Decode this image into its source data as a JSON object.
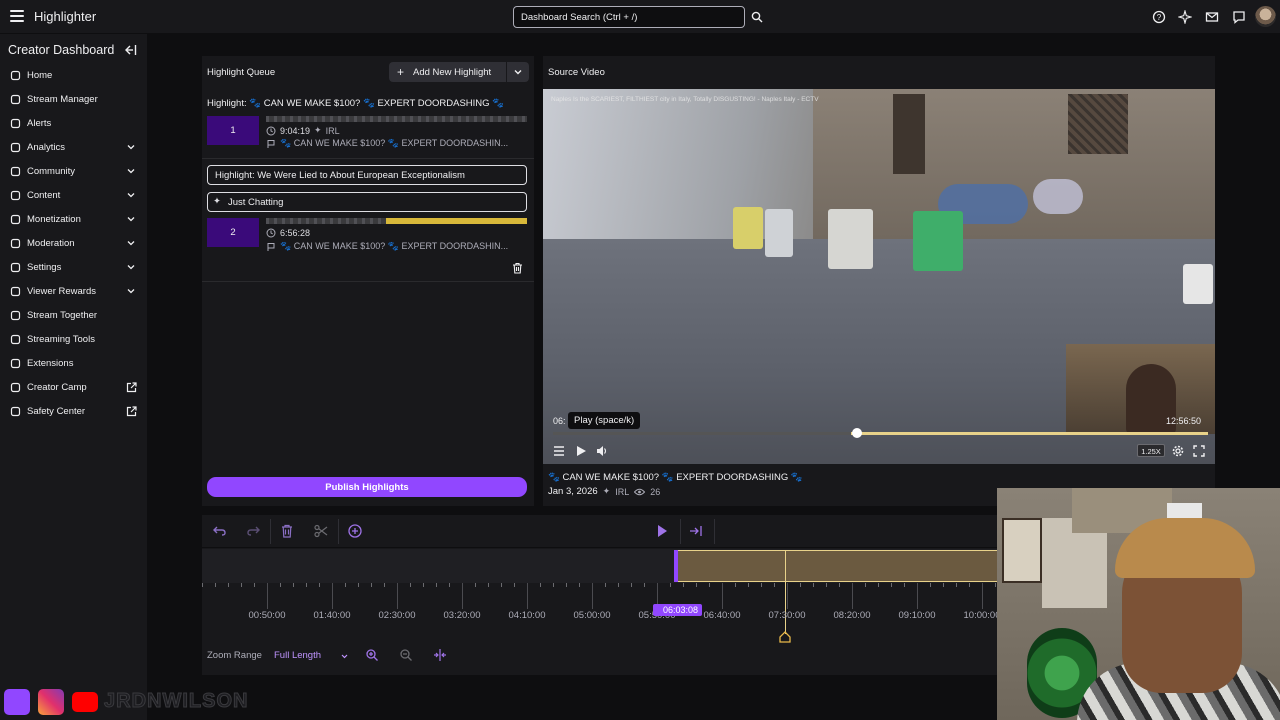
{
  "topbar": {
    "app_title": "Highlighter",
    "search_placeholder": "Dashboard Search (Ctrl + /)"
  },
  "sidebar": {
    "title": "Creator Dashboard",
    "items": [
      {
        "label": "Home",
        "icon": "home-icon",
        "expandable": false,
        "external": false
      },
      {
        "label": "Stream Manager",
        "icon": "stream-manager-icon",
        "expandable": false,
        "external": false
      },
      {
        "label": "Alerts",
        "icon": "alerts-icon",
        "expandable": false,
        "external": false
      },
      {
        "label": "Analytics",
        "icon": "analytics-icon",
        "expandable": true,
        "external": false
      },
      {
        "label": "Community",
        "icon": "community-icon",
        "expandable": true,
        "external": false
      },
      {
        "label": "Content",
        "icon": "content-icon",
        "expandable": true,
        "external": false
      },
      {
        "label": "Monetization",
        "icon": "monetization-icon",
        "expandable": true,
        "external": false
      },
      {
        "label": "Moderation",
        "icon": "moderation-icon",
        "expandable": true,
        "external": false
      },
      {
        "label": "Settings",
        "icon": "settings-icon",
        "expandable": true,
        "external": false
      },
      {
        "label": "Viewer Rewards",
        "icon": "viewer-rewards-icon",
        "expandable": true,
        "external": false
      },
      {
        "label": "Stream Together",
        "icon": "stream-together-icon",
        "expandable": false,
        "external": false
      },
      {
        "label": "Streaming Tools",
        "icon": "streaming-tools-icon",
        "expandable": false,
        "external": false
      },
      {
        "label": "Extensions",
        "icon": "extensions-icon",
        "expandable": false,
        "external": false
      },
      {
        "label": "Creator Camp",
        "icon": "creator-camp-icon",
        "expandable": false,
        "external": true
      },
      {
        "label": "Safety Center",
        "icon": "safety-center-icon",
        "expandable": false,
        "external": true
      }
    ]
  },
  "queue": {
    "header": "Highlight Queue",
    "add_button": "Add New Highlight",
    "item1": {
      "title": "Highlight: 🐾 CAN WE MAKE $100? 🐾 EXPERT DOORDASHING 🐾",
      "number": "1",
      "duration": "9:04:19",
      "category": "IRL",
      "source": "🐾 CAN WE MAKE $100? 🐾 EXPERT DOORDASHIN..."
    },
    "item2": {
      "title_value": "Highlight: We Were Lied to About European Exceptionalism",
      "category_value": "Just Chatting",
      "number": "2",
      "duration": "6:56:28",
      "source": "🐾 CAN WE MAKE $100? 🐾 EXPERT DOORDASHIN..."
    },
    "publish_button": "Publish Highlights"
  },
  "source_video": {
    "header": "Source Video",
    "overlay_caption": "Naples Is the SCARIEST, FILTHIEST city in Italy, Totally DISGUSTING! - Naples Italy - ECTV",
    "tooltip": "Play (space/k)",
    "time_start": "06:",
    "time_end": "12:56:50",
    "speed": "1.25X",
    "progress_fraction": 0.46,
    "title": "🐾 CAN WE MAKE $100? 🐾 EXPERT DOORDASHING 🐾",
    "date": "Jan 3, 2026",
    "category": "IRL",
    "views": "26"
  },
  "timeline": {
    "ticks": [
      "00:50:00",
      "01:40:00",
      "02:30:00",
      "03:20:00",
      "04:10:00",
      "05:00:00",
      "05:50:00",
      "06:40:00",
      "07:30:00",
      "08:20:00",
      "09:10:00",
      "10:00:00"
    ],
    "current_time": "06:03:08",
    "zoom_label": "Zoom Range",
    "zoom_value": "Full Length"
  },
  "overlay": {
    "handle": "JRDNWILSON"
  },
  "colors": {
    "accent": "#9147ff",
    "selection": "#e8d28a",
    "background": "#0e0e10",
    "panel": "#18181b"
  }
}
